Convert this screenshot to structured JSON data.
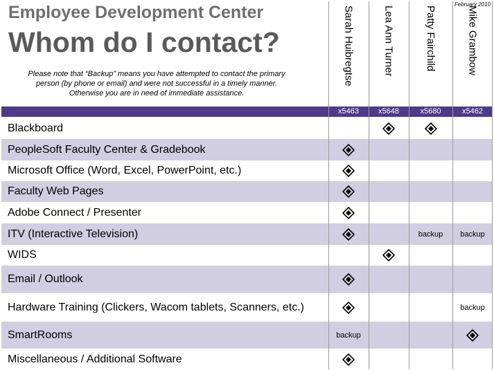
{
  "header": {
    "subtitle": "Employee Development Center",
    "title": "Whom do I contact?",
    "note": "Please note that “Backup” means you have attempted to contact the primary person (by phone or email) and were not successful in a timely manner.  Otherwise you are in need of immediate assistance.",
    "date": "February 2010"
  },
  "contacts": [
    {
      "name": "Sarah Huibregtse",
      "ext": "x5463"
    },
    {
      "name": "Lea Ann Turner",
      "ext": "x5648"
    },
    {
      "name": "Patty Fairchild",
      "ext": "x5680"
    },
    {
      "name": "Mike Grambow",
      "ext": "x5462"
    }
  ],
  "legend": {
    "primary_symbol": "diamond-icon",
    "backup_label": "backup"
  },
  "colors": {
    "header_bar": "#4f3a8a",
    "row_shade": "#d0cee0"
  },
  "rows": [
    {
      "topic": "Blackboard",
      "cells": [
        "",
        "primary",
        "primary",
        ""
      ]
    },
    {
      "topic": "PeopleSoft Faculty Center & Gradebook",
      "cells": [
        "primary",
        "",
        "",
        ""
      ]
    },
    {
      "topic": "Microsoft Office (Word, Excel, PowerPoint, etc.)",
      "cells": [
        "primary",
        "",
        "",
        ""
      ]
    },
    {
      "topic": "Faculty Web Pages",
      "cells": [
        "primary",
        "",
        "",
        ""
      ]
    },
    {
      "topic": "Adobe Connect / Presenter",
      "cells": [
        "primary",
        "",
        "",
        ""
      ]
    },
    {
      "topic": "ITV (Interactive Television)",
      "cells": [
        "primary",
        "",
        "backup",
        "backup"
      ]
    },
    {
      "topic": "WIDS",
      "cells": [
        "",
        "primary",
        "",
        ""
      ]
    },
    {
      "topic": "Email / Outlook",
      "cells": [
        "primary",
        "",
        "",
        ""
      ]
    },
    {
      "topic": "Hardware Training (Clickers, Wacom tablets, Scanners, etc.)",
      "cells": [
        "primary",
        "",
        "",
        "backup"
      ]
    },
    {
      "topic": "SmartRooms",
      "cells": [
        "backup",
        "",
        "",
        "primary"
      ]
    },
    {
      "topic": "Miscellaneous  / Additional Software",
      "cells": [
        "primary",
        "",
        "",
        ""
      ]
    }
  ]
}
